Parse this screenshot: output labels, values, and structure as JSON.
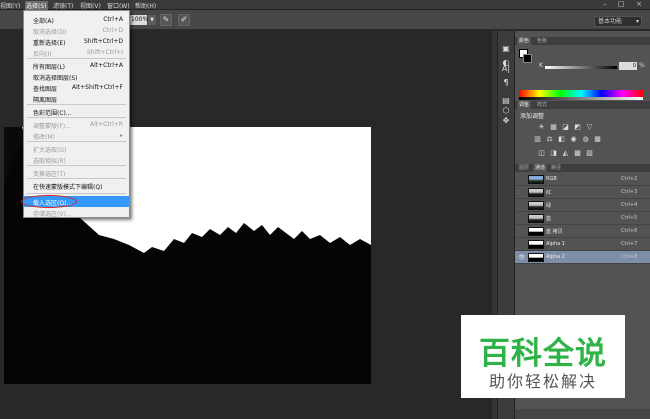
{
  "menubar": {
    "items": [
      {
        "label": "视图(Y)"
      },
      {
        "label": "选择(S)"
      },
      {
        "label": "滤镜(T)"
      },
      {
        "label": "视图(V)"
      },
      {
        "label": "窗口(W)"
      },
      {
        "label": "帮助(H)"
      }
    ],
    "min": "–",
    "restore": "□",
    "close": "×"
  },
  "options_bar": {
    "zoom_value": "100%",
    "zoom_arrow": "▼",
    "icon1": "✎",
    "icon2": "✐",
    "workspace": "基本功能",
    "workspace_caret": "▾"
  },
  "select_menu": {
    "items": [
      {
        "label": "全部(A)",
        "shortcut": "Ctrl+A",
        "disabled": false
      },
      {
        "label": "取消选择(D)",
        "shortcut": "Ctrl+D",
        "disabled": true
      },
      {
        "label": "重新选择(E)",
        "shortcut": "Shift+Ctrl+D",
        "disabled": false
      },
      {
        "label": "反向(I)",
        "shortcut": "Shift+Ctrl+I",
        "disabled": true
      },
      {
        "label": "所有图层(L)",
        "shortcut": "Alt+Ctrl+A",
        "disabled": false
      },
      {
        "label": "取消选择图层(S)",
        "shortcut": "",
        "disabled": false
      },
      {
        "label": "查找图层",
        "shortcut": "Alt+Shift+Ctrl+F",
        "disabled": false
      },
      {
        "label": "隔离图层",
        "shortcut": "",
        "disabled": false
      },
      {
        "label": "色彩范围(C)...",
        "shortcut": "",
        "disabled": false
      },
      {
        "label": "调整蒙版(F)...",
        "shortcut": "Alt+Ctrl+R",
        "disabled": true
      },
      {
        "label": "修改(M)",
        "shortcut": "▸",
        "disabled": true
      },
      {
        "label": "扩大选取(G)",
        "shortcut": "",
        "disabled": true
      },
      {
        "label": "选取相似(R)",
        "shortcut": "",
        "disabled": true
      },
      {
        "label": "变换选区(T)",
        "shortcut": "",
        "disabled": true
      },
      {
        "label": "在快速蒙版模式下编辑(Q)",
        "shortcut": "",
        "disabled": false
      },
      {
        "label": "载入选区(O)...",
        "shortcut": "",
        "disabled": false
      },
      {
        "label": "存储选区(V)...",
        "shortcut": "",
        "disabled": true
      }
    ]
  },
  "tools": [
    {
      "glyph": "▣"
    },
    {
      "glyph": "◐"
    },
    {
      "glyph": "A|"
    },
    {
      "glyph": "¶"
    },
    {
      "glyph": "▤"
    },
    {
      "glyph": "⬡"
    },
    {
      "glyph": "✥"
    }
  ],
  "color_panel": {
    "tab_color": "颜色",
    "tab_swatches": "色板",
    "k_label": "K",
    "k_value": "0",
    "k_unit": "%"
  },
  "adjust_panel": {
    "tab_adjust": "调整",
    "tab_styles": "样式",
    "label": "添加调整",
    "row1": [
      "☀",
      "▦",
      "◪",
      "◩",
      "▽"
    ],
    "row2": [
      "▥",
      "⚖",
      "◧",
      "◉",
      "◍",
      "▦"
    ],
    "row3": [
      "◫",
      "◨",
      "◭",
      "▩",
      "▧"
    ]
  },
  "channels_panel": {
    "tab_layers": "图层",
    "tab_channels": "通道",
    "tab_paths": "路径",
    "rows": [
      {
        "name": "RGB",
        "shortcut": "Ctrl+2",
        "thumb": "rgb",
        "selected": false,
        "eye": ""
      },
      {
        "name": "红",
        "shortcut": "Ctrl+3",
        "thumb": "gray",
        "selected": false,
        "eye": ""
      },
      {
        "name": "绿",
        "shortcut": "Ctrl+4",
        "thumb": "gray",
        "selected": false,
        "eye": ""
      },
      {
        "name": "蓝",
        "shortcut": "Ctrl+5",
        "thumb": "gray",
        "selected": false,
        "eye": ""
      },
      {
        "name": "蓝 拷贝",
        "shortcut": "Ctrl+6",
        "thumb": "bw",
        "selected": false,
        "eye": ""
      },
      {
        "name": "Alpha 1",
        "shortcut": "Ctrl+7",
        "thumb": "bw",
        "selected": false,
        "eye": ""
      },
      {
        "name": "Alpha 2",
        "shortcut": "Ctrl+8",
        "thumb": "bw",
        "selected": true,
        "eye": "👁"
      }
    ]
  },
  "watermark": {
    "title": "百科全说",
    "subtitle": "助你轻松解决"
  },
  "colors": {
    "menu_highlight": "#3399ff",
    "selected_row": "#7d8ea6",
    "circle_annotation": "#d8261c",
    "watermark_green": "#2fb346"
  }
}
